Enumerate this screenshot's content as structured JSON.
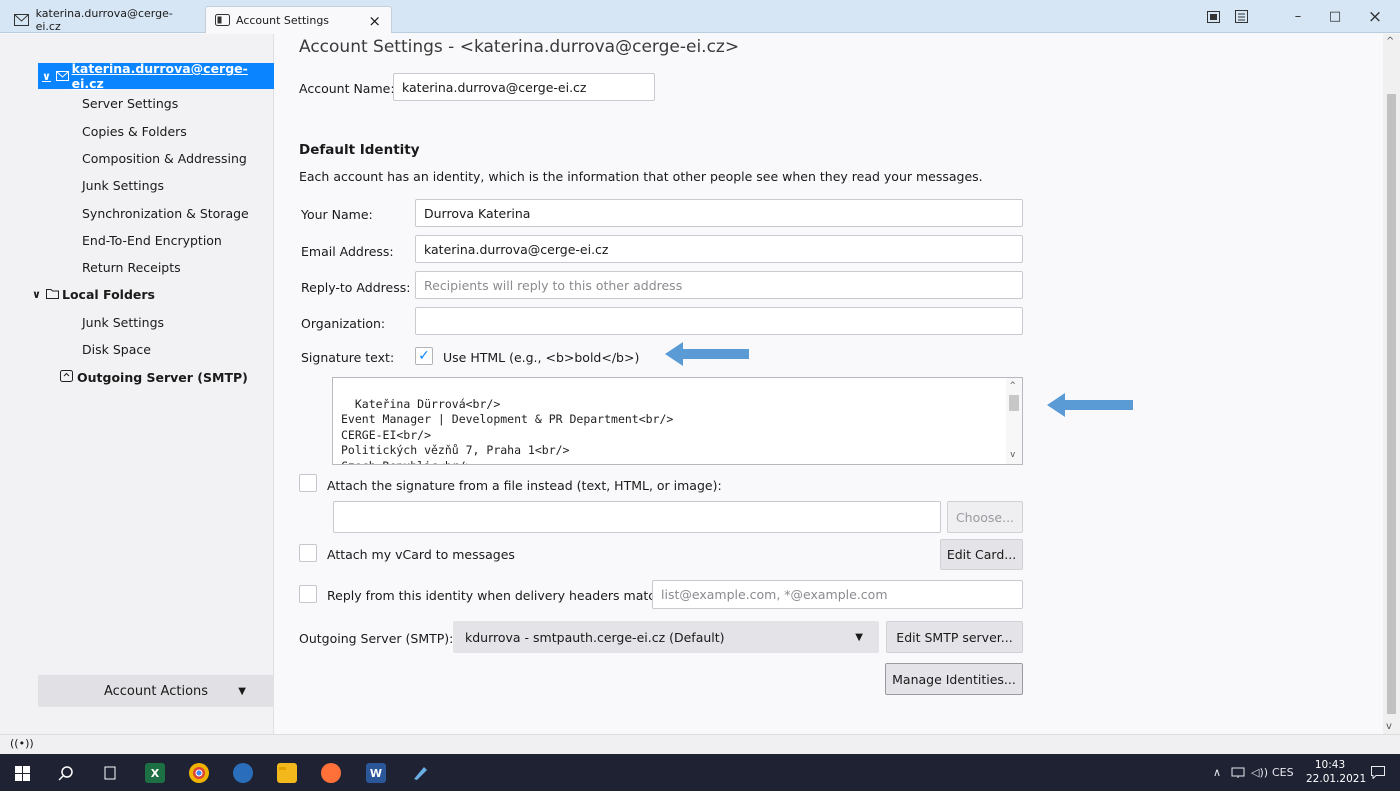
{
  "tabs": [
    {
      "label": "katerina.durrova@cerge-ei.cz",
      "icon": "mail-tab-icon"
    },
    {
      "label": "Account Settings",
      "icon": "settings-tab-icon"
    }
  ],
  "window_controls": {
    "minimize": "–",
    "maximize": "□",
    "close": "×",
    "tab_close": "×"
  },
  "sidebar": {
    "account": "katerina.durrova@cerge-ei.cz",
    "account_items": [
      "Server Settings",
      "Copies & Folders",
      "Composition & Addressing",
      "Junk Settings",
      "Synchronization & Storage",
      "End-To-End Encryption",
      "Return Receipts"
    ],
    "local_folders": "Local Folders",
    "local_items": [
      "Junk Settings",
      "Disk Space"
    ],
    "outgoing": "Outgoing Server (SMTP)",
    "account_actions": "Account Actions"
  },
  "main": {
    "title": "Account Settings - <katerina.durrova@cerge-ei.cz>",
    "account_name_label": "Account Name:",
    "account_name_value": "katerina.durrova@cerge-ei.cz",
    "default_identity": "Default Identity",
    "identity_desc": "Each account has an identity, which is the information that other people see when they read your messages.",
    "your_name_label": "Your Name:",
    "your_name_value": "Durrova Katerina",
    "email_label": "Email Address:",
    "email_value": "katerina.durrova@cerge-ei.cz",
    "reply_label": "Reply-to Address:",
    "reply_placeholder": "Recipients will reply to this other address",
    "org_label": "Organization:",
    "org_value": "",
    "sig_label": "Signature text:",
    "use_html_label": "Use HTML (e.g., <b>bold</b>)",
    "use_html_checked": true,
    "signature_text": "Kateřina Dürrová<br/>\nEvent Manager | Development & PR Department<br/>\nCERGE-EI<br/>\nPolitických vězňů 7, Praha 1<br/>\nCzech Republic<br/>",
    "attach_sig_label": "Attach the signature from a file instead (text, HTML, or image):",
    "choose_button": "Choose...",
    "vcard_label": "Attach my vCard to messages",
    "edit_card_button": "Edit Card...",
    "reply_identity_label": "Reply from this identity when delivery headers match:",
    "reply_identity_placeholder": "list@example.com, *@example.com",
    "smtp_label": "Outgoing Server (SMTP):",
    "smtp_value": "kdurrova - smtpauth.cerge-ei.cz (Default)",
    "edit_smtp_button": "Edit SMTP server...",
    "manage_identities_button": "Manage Identities..."
  },
  "arrow_color": "#5b9bd5",
  "accent_color": "#0a84ff",
  "taskbar": {
    "lang": "CES",
    "time": "10:43",
    "date": "22.01.2021"
  }
}
